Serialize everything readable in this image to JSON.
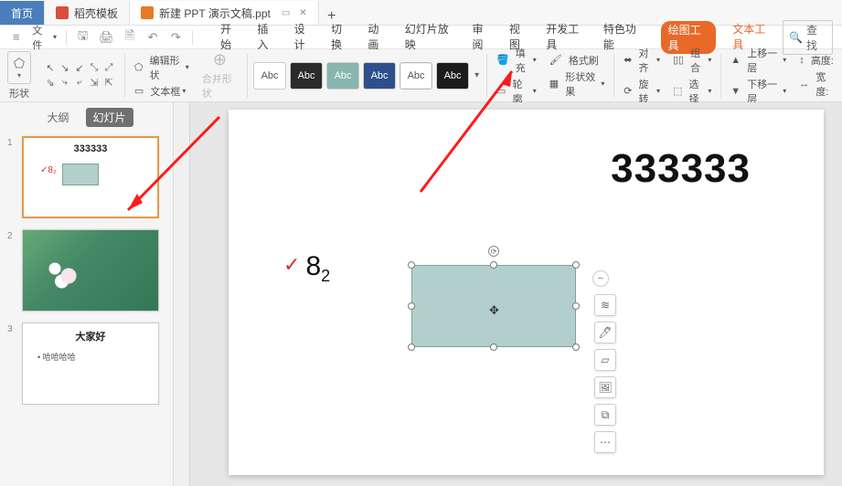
{
  "tabs": {
    "home": "首页",
    "docx": "稻壳模板",
    "ppt": "新建 PPT 演示文稿.ppt"
  },
  "quick": {
    "file": "文件"
  },
  "menu": {
    "start": "开始",
    "insert": "插入",
    "design": "设计",
    "transition": "切换",
    "animation": "动画",
    "slideshow": "幻灯片放映",
    "review": "审阅",
    "view": "视图",
    "devtools": "开发工具",
    "special": "特色功能",
    "drawtools": "绘图工具",
    "texttools": "文本工具",
    "search": "查找"
  },
  "ribbon": {
    "shape_lbl": "形状",
    "edit_shape": "编辑形状",
    "textbox": "文本框",
    "merge_shape": "合并形状",
    "abc": "Abc",
    "fill": "填充",
    "outline": "轮廓",
    "formatbrush": "格式刷",
    "shapeeffect": "形状效果",
    "align": "对齐",
    "rotate": "旋转",
    "group": "组合",
    "select": "选择",
    "bringfwd": "上移一层",
    "sendback": "下移一层",
    "height": "高度:",
    "width": "宽度:"
  },
  "pane": {
    "outline": "大纲",
    "slides": "幻灯片"
  },
  "thumbs": [
    {
      "num": "1",
      "title": "333333",
      "bullet": "8₂"
    },
    {
      "num": "2"
    },
    {
      "num": "3",
      "title": "大家好",
      "sub": "哈哈哈哈"
    }
  ],
  "slide": {
    "title": "333333",
    "bullet_main": "8",
    "bullet_sub": "2"
  }
}
